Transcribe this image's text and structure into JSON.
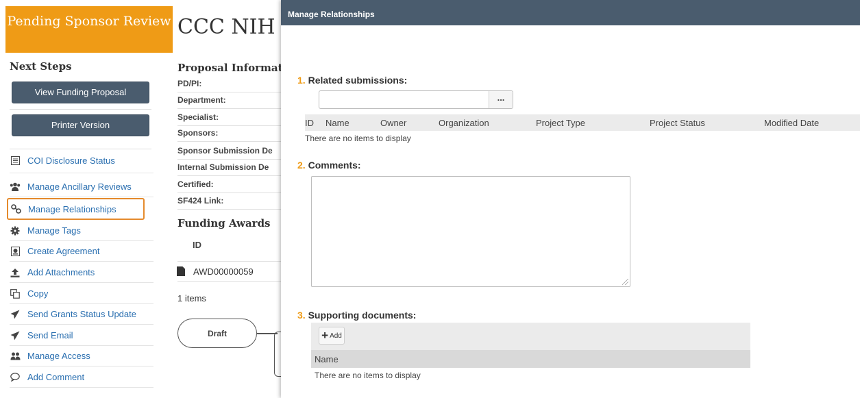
{
  "sidebar": {
    "state": "Pending Sponsor Review",
    "next_steps_title": "Next Steps",
    "view_button": "View Funding Proposal",
    "printer_button": "Printer Version",
    "items": [
      {
        "label": "COI Disclosure Status",
        "icon": "list-icon"
      },
      {
        "label": "Manage Ancillary Reviews",
        "icon": "users-icon"
      },
      {
        "label": "Manage Relationships",
        "icon": "link-icon"
      },
      {
        "label": "Manage Tags",
        "icon": "gear-icon"
      },
      {
        "label": "Create Agreement",
        "icon": "document-icon"
      },
      {
        "label": "Add Attachments",
        "icon": "upload-icon"
      },
      {
        "label": "Copy",
        "icon": "copy-icon"
      },
      {
        "label": "Send Grants Status Update",
        "icon": "paper-plane-icon"
      },
      {
        "label": "Send Email",
        "icon": "paper-plane-icon"
      },
      {
        "label": "Manage Access",
        "icon": "people-icon"
      },
      {
        "label": "Add Comment",
        "icon": "comment-icon"
      }
    ]
  },
  "workspace": {
    "title": "CCC NIH T",
    "proposal_info_title": "Proposal Informatio",
    "fields": [
      "PD/PI:",
      "Department:",
      "Specialist:",
      "Sponsors:",
      "Sponsor Submission De",
      "Internal Submission De",
      "Certified:",
      "SF424 Link:"
    ],
    "funding_awards_title": "Funding Awards",
    "awards_col_id": "ID",
    "award_id": "AWD00000059",
    "items_count": "1 items",
    "flow_draft": "Draft"
  },
  "modal": {
    "title": "Manage Relationships",
    "q1_num": "1.",
    "q1_label": "Related submissions:",
    "chooser_button": "...",
    "columns": [
      "ID",
      "Name",
      "Owner",
      "Organization",
      "Project Type",
      "Project Status",
      "Modified Date"
    ],
    "related_empty": "There are no items to display",
    "q2_num": "2.",
    "q2_label": "Comments:",
    "q3_num": "3.",
    "q3_label": "Supporting documents:",
    "add_label": "Add",
    "docs_col_name": "Name",
    "docs_empty": "There are no items to display"
  },
  "colors": {
    "state_orange": "#ef9b16",
    "header_slate": "#4a5c6e",
    "link_blue": "#2a6fb0",
    "highlight_orange": "#e58a2c"
  }
}
